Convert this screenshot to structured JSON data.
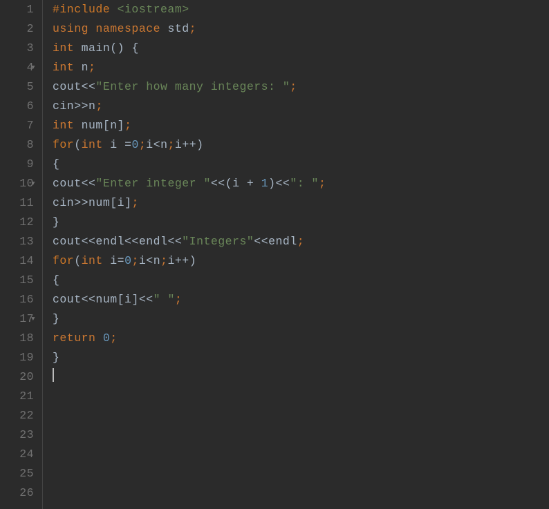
{
  "editor": {
    "lineNumbers": [
      "1",
      "2",
      "3",
      "4",
      "5",
      "6",
      "7",
      "8",
      "9",
      "10",
      "11",
      "12",
      "13",
      "14",
      "15",
      "16",
      "17",
      "18",
      "19",
      "20",
      "21",
      "22",
      "23",
      "24",
      "25",
      "26"
    ],
    "foldLines": [
      4,
      10,
      17
    ],
    "code": {
      "l1": {
        "preproc": "#include",
        "space": " ",
        "lib": "<iostream>"
      },
      "l2": {
        "using": "using",
        "space": " ",
        "ns": "namespace",
        "space2": " ",
        "std": "std",
        "semi": ";"
      },
      "l3": {
        "blank": ""
      },
      "l4": {
        "type": "int",
        "space": " ",
        "func": "main",
        "paren": "()",
        "space2": " ",
        "brace": "{"
      },
      "l5": {
        "type": "int",
        "space": " ",
        "var": "n",
        "semi": ";"
      },
      "l6": {
        "obj": "cout",
        "op": "<<",
        "str": "\"Enter how many integers: \"",
        "semi": ";"
      },
      "l7": {
        "obj": "cin",
        "op": ">>",
        "var": "n",
        "semi": ";"
      },
      "l8": {
        "type": "int",
        "space": " ",
        "var": "num",
        "bracket": "[",
        "idx": "n",
        "bracket2": "]",
        "semi": ";"
      },
      "l9": {
        "kw": "for",
        "paren": "(",
        "type": "int",
        "space": " ",
        "var": "i",
        "space2": " ",
        "eq": "=",
        "num": "0",
        "semi": ";",
        "var2": "i",
        "op": "<",
        "var3": "n",
        "semi2": ";",
        "var4": "i",
        "op2": "++",
        "paren2": ")"
      },
      "l10": {
        "brace": "{"
      },
      "l11": {
        "obj": "cout",
        "op": "<<",
        "str": "\"Enter integer \"",
        "op2": "<<",
        "paren": "(",
        "var": "i",
        "space": " ",
        "plus": "+",
        "space2": " ",
        "num": "1",
        "paren2": ")",
        "op3": "<<",
        "str2": "\": \"",
        "semi": ";"
      },
      "l12": {
        "obj": "cin",
        "op": ">>",
        "var": "num",
        "bracket": "[",
        "idx": "i",
        "bracket2": "]",
        "semi": ";"
      },
      "l13": {
        "brace": "}"
      },
      "l14": {
        "blank": ""
      },
      "l15": {
        "obj": "cout",
        "op": "<<",
        "endl": "endl",
        "op2": "<<",
        "endl2": "endl",
        "op3": "<<",
        "str": "\"Integers\"",
        "op4": "<<",
        "endl3": "endl",
        "semi": ";"
      },
      "l16": {
        "kw": "for",
        "paren": "(",
        "type": "int",
        "space": " ",
        "var": "i",
        "eq": "=",
        "num": "0",
        "semi": ";",
        "var2": "i",
        "op": "<",
        "var3": "n",
        "semi2": ";",
        "var4": "i",
        "op2": "++",
        "paren2": ")"
      },
      "l17": {
        "brace": "{"
      },
      "l18": {
        "obj": "cout",
        "op": "<<",
        "var": "num",
        "bracket": "[",
        "idx": "i",
        "bracket2": "]",
        "op2": "<<",
        "str": "\" \"",
        "semi": ";"
      },
      "l19": {
        "brace": "}"
      },
      "l20": {
        "blank": ""
      },
      "l21": {
        "blank": ""
      },
      "l22": {
        "ret": "return",
        "space": " ",
        "num": "0",
        "semi": ";"
      },
      "l23": {
        "blank": ""
      },
      "l24": {
        "brace": "}"
      },
      "l25": {
        "cursor": true
      },
      "l26": {
        "blank": ""
      }
    }
  }
}
